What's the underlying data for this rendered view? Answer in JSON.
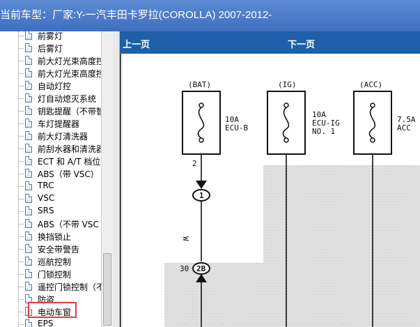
{
  "window": {
    "title": "当前车型：厂家:Y-一汽丰田卡罗拉(COROLLA) 2007-2012-"
  },
  "tree": {
    "items": [
      {
        "label": "前雾灯"
      },
      {
        "label": "后雾灯"
      },
      {
        "label": "前大灯光束高度控"
      },
      {
        "label": "前大灯光束高度控"
      },
      {
        "label": "自动灯控"
      },
      {
        "label": "灯自动熄灭系统"
      },
      {
        "label": "钥匙提醒（不带智"
      },
      {
        "label": "车灯提醒器"
      },
      {
        "label": "前大灯清洗器"
      },
      {
        "label": "前刮水器和清洗器"
      },
      {
        "label": "ECT 和 A/T 档位"
      },
      {
        "label": "ABS（带 VSC）"
      },
      {
        "label": "TRC"
      },
      {
        "label": "VSC"
      },
      {
        "label": "SRS"
      },
      {
        "label": "ABS（不带 VSC"
      },
      {
        "label": "换挡锁止"
      },
      {
        "label": "安全带警告"
      },
      {
        "label": "巡航控制"
      },
      {
        "label": "门锁控制"
      },
      {
        "label": "遥控门锁控制（不"
      },
      {
        "label": "防盗"
      },
      {
        "label": "电动车窗"
      },
      {
        "label": "EPS"
      }
    ],
    "selected_index": 22,
    "highlight_color": "#e23b3b"
  },
  "nav": {
    "prev_label": "上一页",
    "next_label": "下一页",
    "bar_color": "#1d5fa8"
  },
  "diagram": {
    "fuses": [
      {
        "source": "(BAT)",
        "rating": "10A",
        "name_lines": [
          "ECU-B"
        ]
      },
      {
        "source": "(IG)",
        "rating": "10A",
        "name_lines": [
          "ECU-IG",
          "NO. 1"
        ]
      },
      {
        "source": "(ACC)",
        "rating": "7.5A",
        "name_lines": [
          "ACC"
        ]
      }
    ],
    "pin_top": "2",
    "connector_top": "1",
    "wire_color": "W",
    "pin_bottom": "30",
    "connector_bottom": "2B"
  }
}
